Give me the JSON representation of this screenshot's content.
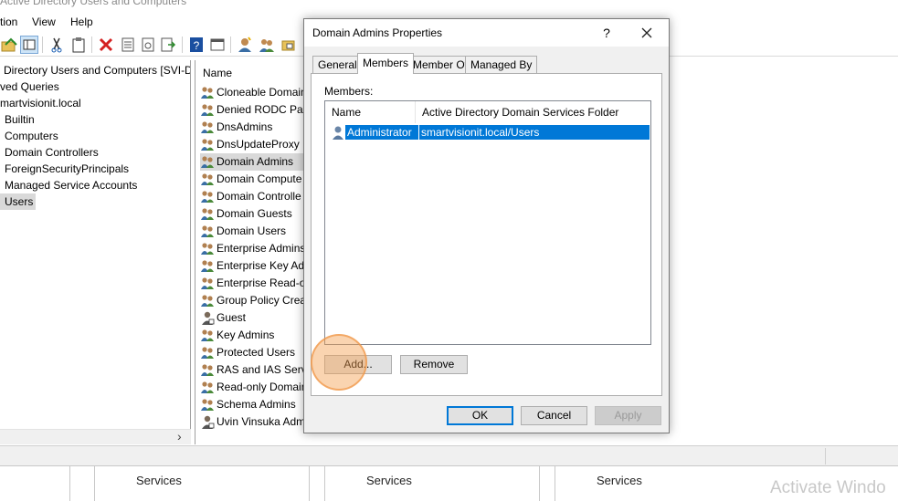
{
  "window": {
    "title": "Active Directory Users and Computers"
  },
  "menu": {
    "items": [
      "tion",
      "View",
      "Help"
    ]
  },
  "tree": {
    "items": [
      {
        "label": "Directory Users and Computers [SVI-DC",
        "selected": false
      },
      {
        "label": "ved Queries",
        "selected": false
      },
      {
        "label": "martvisionit.local",
        "selected": false
      },
      {
        "label": "Builtin",
        "selected": false
      },
      {
        "label": "Computers",
        "selected": false
      },
      {
        "label": "Domain Controllers",
        "selected": false
      },
      {
        "label": "ForeignSecurityPrincipals",
        "selected": false
      },
      {
        "label": "Managed Service Accounts",
        "selected": false
      },
      {
        "label": "Users",
        "selected": true
      }
    ],
    "scroll_right_arrow": "›"
  },
  "list": {
    "column_name": "Name",
    "rows": [
      {
        "label": "Cloneable Domain",
        "icon": "group-icon",
        "selected": false
      },
      {
        "label": "Denied RODC Pass",
        "icon": "group-icon",
        "selected": false
      },
      {
        "label": "DnsAdmins",
        "icon": "group-icon",
        "selected": false
      },
      {
        "label": "DnsUpdateProxy",
        "icon": "group-icon",
        "selected": false
      },
      {
        "label": "Domain Admins",
        "icon": "group-icon",
        "selected": true
      },
      {
        "label": "Domain Compute",
        "icon": "group-icon",
        "selected": false
      },
      {
        "label": "Domain Controlle",
        "icon": "group-icon",
        "selected": false
      },
      {
        "label": "Domain Guests",
        "icon": "group-icon",
        "selected": false
      },
      {
        "label": "Domain Users",
        "icon": "group-icon",
        "selected": false
      },
      {
        "label": "Enterprise Admins",
        "icon": "group-icon",
        "selected": false
      },
      {
        "label": "Enterprise Key Adr",
        "icon": "group-icon",
        "selected": false
      },
      {
        "label": "Enterprise Read-o",
        "icon": "group-icon",
        "selected": false
      },
      {
        "label": "Group Policy Crea",
        "icon": "group-icon",
        "selected": false
      },
      {
        "label": "Guest",
        "icon": "user-icon",
        "selected": false
      },
      {
        "label": "Key Admins",
        "icon": "group-icon",
        "selected": false
      },
      {
        "label": "Protected Users",
        "icon": "group-icon",
        "selected": false
      },
      {
        "label": "RAS and IAS Serve",
        "icon": "group-icon",
        "selected": false
      },
      {
        "label": "Read-only Domain",
        "icon": "group-icon",
        "selected": false
      },
      {
        "label": "Schema Admins",
        "icon": "group-icon",
        "selected": false
      },
      {
        "label": "Uvin Vinsuka Adm",
        "icon": "user-icon",
        "selected": false
      }
    ]
  },
  "dialog": {
    "title": "Domain Admins Properties",
    "help": "?",
    "tabs": [
      {
        "label": "General",
        "active": false
      },
      {
        "label": "Members",
        "active": true
      },
      {
        "label": "Member Of",
        "active": false
      },
      {
        "label": "Managed By",
        "active": false
      }
    ],
    "members_label": "Members:",
    "columns": {
      "name": "Name",
      "folder": "Active Directory Domain Services Folder"
    },
    "members": [
      {
        "name": "Administrator",
        "folder": "smartvisionit.local/Users",
        "selected": true
      }
    ],
    "add_button": "Add...",
    "remove_button": "Remove",
    "ok_button": "OK",
    "cancel_button": "Cancel",
    "apply_button": "Apply"
  },
  "taskbar": {
    "services": [
      "Services",
      "Services",
      "Services"
    ],
    "watermark": "Activate Windo"
  },
  "colors": {
    "selection_blue": "#0078d7",
    "highlight_orange": "#f5a050"
  }
}
